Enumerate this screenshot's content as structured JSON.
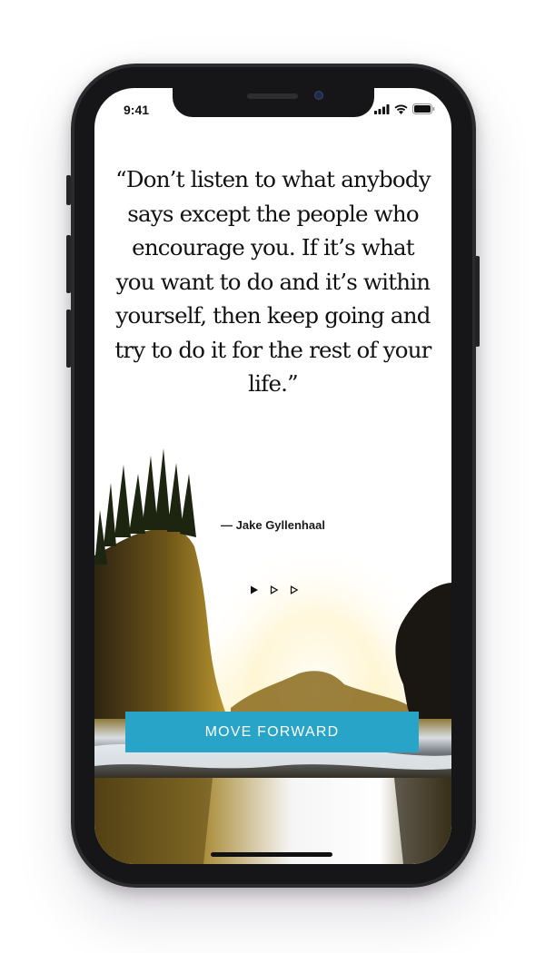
{
  "status_bar": {
    "time": "9:41",
    "icons": [
      "signal-icon",
      "wifi-icon",
      "battery-icon"
    ]
  },
  "quote": {
    "text": "“Don’t listen to what anybody says except the people who encourage you. If it’s what you want to do and it’s within yourself, then keep going and try to do it for the rest of your life.”",
    "author": "— Jake Gyllenhaal"
  },
  "pager": {
    "count": 3,
    "active_index": 0
  },
  "cta": {
    "label": "MOVE FORWARD",
    "color": "#27a4c8"
  },
  "colors": {
    "accent": "#27a4c8",
    "text": "#111111"
  }
}
